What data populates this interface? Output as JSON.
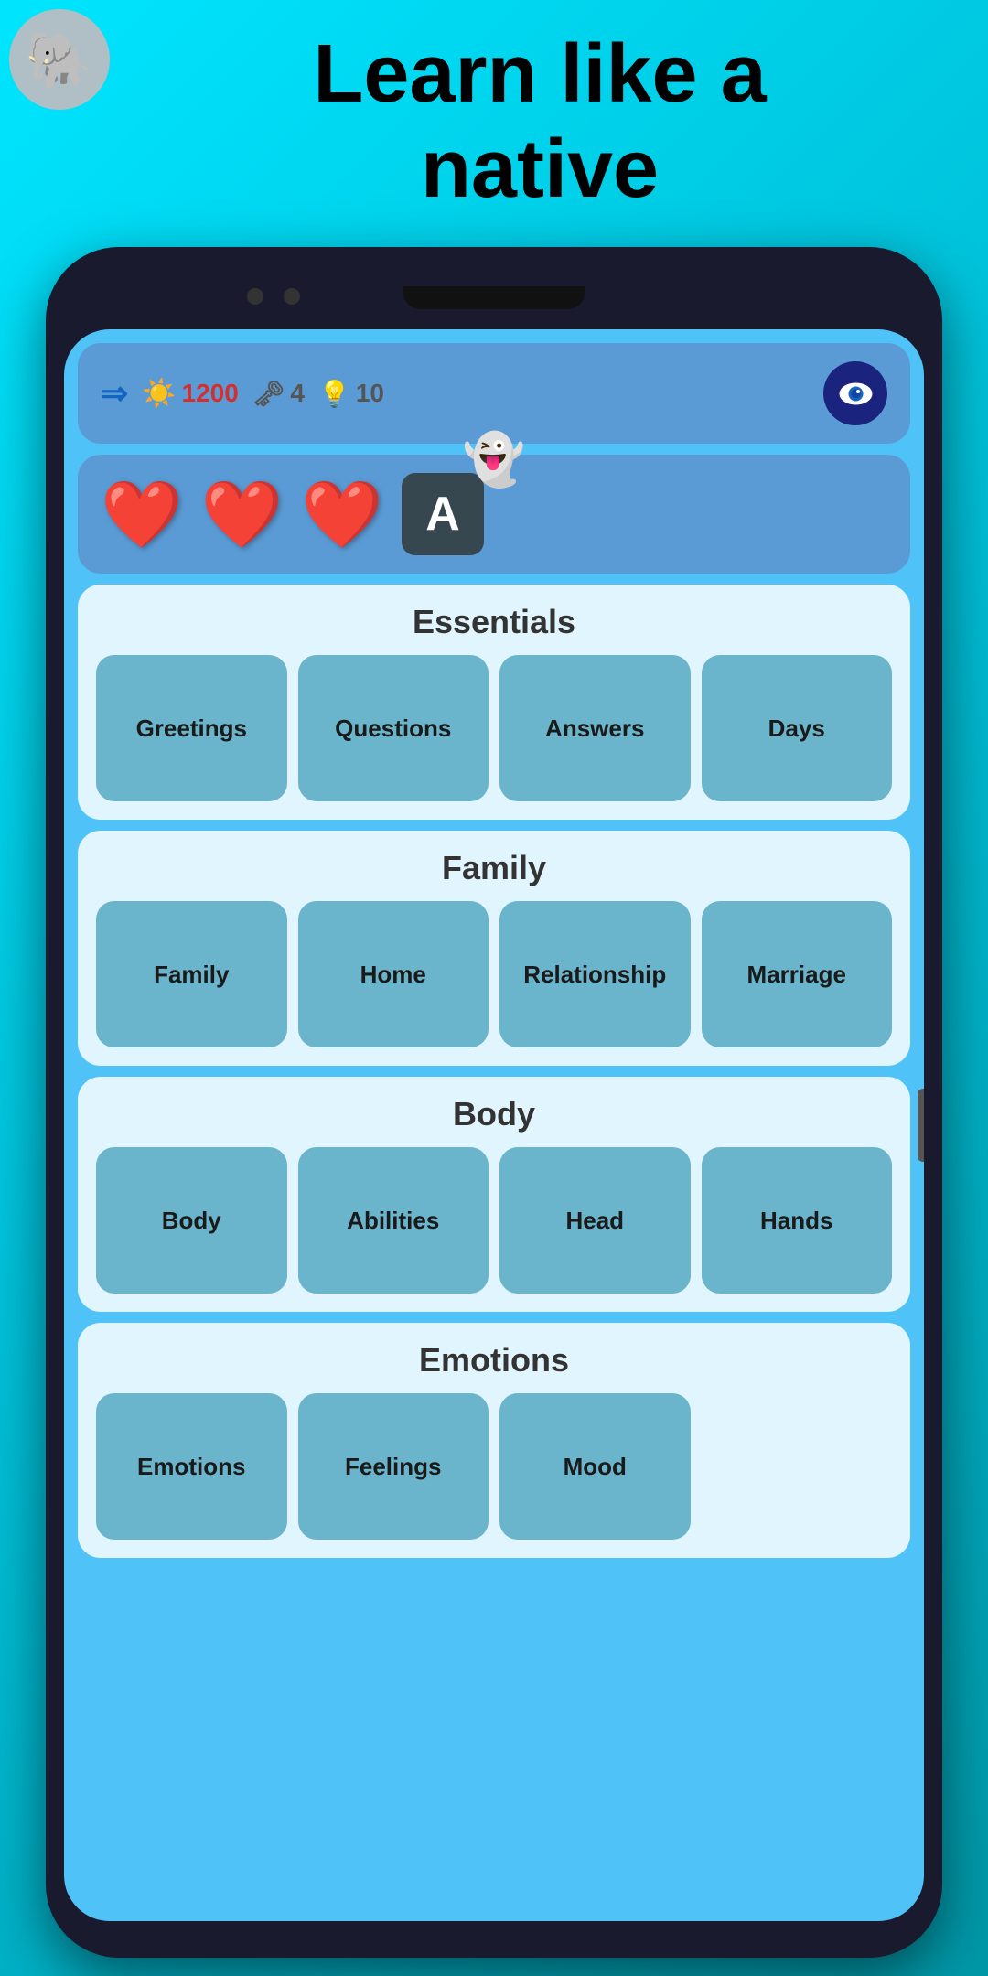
{
  "hero": {
    "title_line1": "Learn like a",
    "title_line2": "native"
  },
  "stats": {
    "points": "1200",
    "keys": "4",
    "bulbs": "10"
  },
  "lives": {
    "hearts": [
      "❤️",
      "❤️",
      "❤️"
    ]
  },
  "sections": [
    {
      "id": "essentials",
      "title": "Essentials",
      "items": [
        "Greetings",
        "Questions",
        "Answers",
        "Days"
      ]
    },
    {
      "id": "family",
      "title": "Family",
      "items": [
        "Family",
        "Home",
        "Relationship",
        "Marriage"
      ]
    },
    {
      "id": "body",
      "title": "Body",
      "items": [
        "Body",
        "Abilities",
        "Head",
        "Hands"
      ]
    },
    {
      "id": "emotions",
      "title": "Emotions",
      "items": [
        "Emotions",
        "Feelings",
        "Mood"
      ]
    }
  ],
  "icons": {
    "mascot": "🐘",
    "cloud": "👻",
    "sun": "☀️",
    "key": "🗝",
    "bulb": "💡",
    "arrows": "⇒",
    "letter": "A",
    "eye": "👁️"
  }
}
